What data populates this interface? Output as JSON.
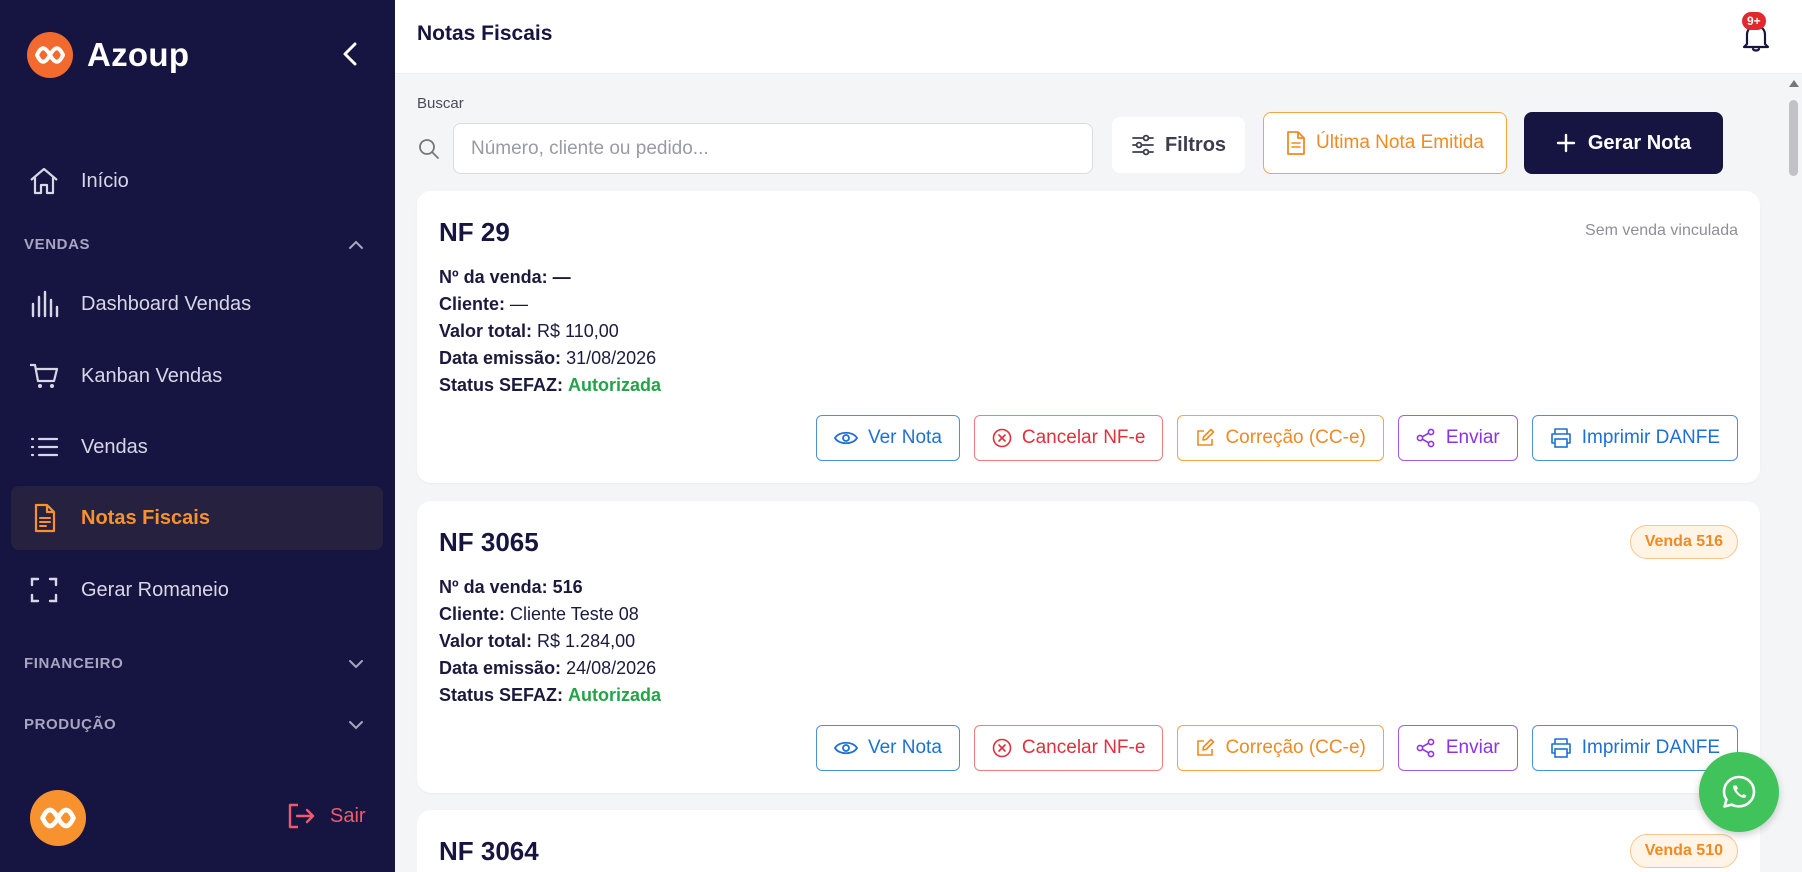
{
  "brand": {
    "name": "Azoup"
  },
  "sidebar": {
    "home": "Início",
    "sections": {
      "vendas": "VENDAS",
      "financeiro": "FINANCEIRO",
      "producao": "PRODUÇÃO"
    },
    "items": [
      {
        "label": "Dashboard Vendas",
        "icon": "bar-chart-icon"
      },
      {
        "label": "Kanban Vendas",
        "icon": "cart-icon"
      },
      {
        "label": "Vendas",
        "icon": "list-icon"
      },
      {
        "label": "Notas Fiscais",
        "icon": "document-icon",
        "active": true
      },
      {
        "label": "Gerar Romaneio",
        "icon": "scan-icon"
      }
    ],
    "logout": "Sair"
  },
  "header": {
    "title": "Notas Fiscais",
    "notifications_badge": "9+"
  },
  "search": {
    "label": "Buscar",
    "placeholder": "Número, cliente ou pedido...",
    "value": ""
  },
  "toolbar": {
    "filters": "Filtros",
    "last_note": "Última Nota Emitida",
    "generate": "Gerar Nota"
  },
  "labels": {
    "sale_no": "Nº da venda:",
    "client": "Cliente:",
    "total": "Valor total:",
    "issue_date": "Data emissão:",
    "status": "Status SEFAZ:"
  },
  "actions": {
    "view": "Ver Nota",
    "cancel": "Cancelar NF-e",
    "correction": "Correção (CC-e)",
    "send": "Enviar",
    "print": "Imprimir DANFE"
  },
  "notes": [
    {
      "title": "NF 29",
      "tag": "Sem venda vinculada",
      "sale_no": "—",
      "client": "—",
      "total": "R$ 110,00",
      "issue_date": "31/08/2026",
      "status": "Autorizada"
    },
    {
      "title": "NF 3065",
      "tag": "Venda 516",
      "sale_no": "516",
      "client": "Cliente Teste 08",
      "total": "R$ 1.284,00",
      "issue_date": "24/08/2026",
      "status": "Autorizada"
    },
    {
      "title": "NF 3064",
      "tag": "Venda 510"
    }
  ],
  "colors": {
    "sidebar_bg": "#161441",
    "accent": "#f7922e",
    "success": "#22a447",
    "danger": "#e0303c"
  }
}
